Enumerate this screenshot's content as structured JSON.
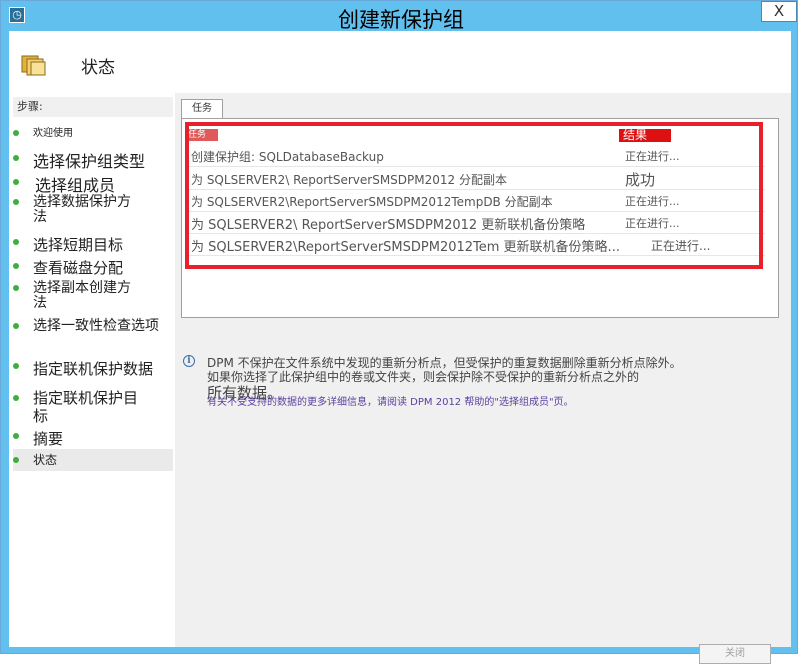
{
  "window": {
    "title": "创建新保护组",
    "close_glyph": "X"
  },
  "header": {
    "title": "状态",
    "icon": "folder-icon"
  },
  "steps": {
    "label": "步骤:",
    "items": [
      "欢迎使用",
      "选择保护组类型",
      "选择组成员",
      "选择数据保护方法",
      "选择短期目标",
      "查看磁盘分配",
      "选择副本创建方法",
      "选择一致性检查选项",
      "指定联机保护数据",
      "指定联机保护目标",
      "摘要",
      "状态"
    ]
  },
  "tab": {
    "label": "任务"
  },
  "table": {
    "headers": {
      "task": "任务",
      "result": "结果"
    },
    "rows": [
      {
        "task": "创建保护组: SQLDatabaseBackup",
        "result": "正在进行..."
      },
      {
        "task": "为 SQLSERVER2\\ ReportServerSMSDPM2012 分配副本",
        "result": "成功"
      },
      {
        "task": "为 SQLSERVER2\\ReportServerSMSDPM2012TempDB 分配副本",
        "result": "正在进行..."
      },
      {
        "task": "为 SQLSERVER2\\ ReportServerSMSDPM2012 更新联机备份策略",
        "result": "正在进行..."
      },
      {
        "task": "为 SQLSERVER2\\ReportServerSMSDPM2012Tem 更新联机备份策略...",
        "result": "正在进行..."
      }
    ]
  },
  "info": {
    "line1": "DPM 不保护在文件系统中发现的重新分析点，但受保护的重复数据删除重新分析点除外。",
    "line2": "如果你选择了此保护组中的卷或文件夹，则会保护除不受保护的重新分析点之外的",
    "line3": "所有数据。",
    "link": "有关不受支持的数据的更多详细信息，请阅读 DPM 2012 帮助的\"选择组成员\"页。"
  },
  "footer": {
    "close_label": "关闭"
  },
  "colors": {
    "titlebar": "#62c0ee",
    "highlight": "#e8202a",
    "step_dot": "#3fae3f"
  }
}
